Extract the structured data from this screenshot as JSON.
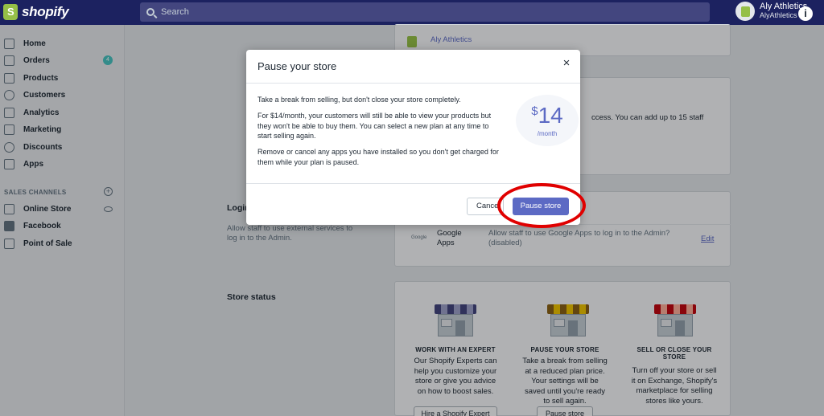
{
  "topbar": {
    "logo_text": "shopify",
    "search_placeholder": "Search",
    "account_name": "Aly Athletics",
    "account_sub": "AlyAthletics",
    "info_glyph": "i"
  },
  "sidebar": {
    "items": [
      {
        "label": "Home",
        "icon": "home-icon"
      },
      {
        "label": "Orders",
        "icon": "orders-icon",
        "badge": "4"
      },
      {
        "label": "Products",
        "icon": "tag-icon"
      },
      {
        "label": "Customers",
        "icon": "person-icon"
      },
      {
        "label": "Analytics",
        "icon": "bar-chart-icon"
      },
      {
        "label": "Marketing",
        "icon": "megaphone-icon"
      },
      {
        "label": "Discounts",
        "icon": "discount-icon"
      },
      {
        "label": "Apps",
        "icon": "apps-icon"
      }
    ],
    "sales_channels_heading": "SALES CHANNELS",
    "channels": [
      {
        "label": "Online Store",
        "icon": "store-icon"
      },
      {
        "label": "Facebook",
        "icon": "facebook-icon"
      },
      {
        "label": "Point of Sale",
        "icon": "bag-icon"
      }
    ]
  },
  "main": {
    "store_owner_name": "Aly Athletics",
    "staff_text": "ccess. You can add up to 15 staff",
    "login_title": "Login",
    "login_desc": "Allow staff to use external services to log in to the Admin.",
    "google_logo": "Google",
    "google_apps_label": "Google Apps",
    "google_apps_desc": "Allow staff to use Google Apps to log in to the Admin? (disabled)",
    "edit_link": "Edit",
    "store_status_title": "Store status",
    "columns": [
      {
        "title": "WORK WITH AN EXPERT",
        "desc": "Our Shopify Experts can help you customize your store or give you advice on how to boost sales.",
        "button": "Hire a Shopify Expert"
      },
      {
        "title": "PAUSE YOUR STORE",
        "desc": "Take a break from selling at a reduced plan price. Your settings will be saved until you're ready to sell again.",
        "button": "Pause store"
      },
      {
        "title": "SELL OR CLOSE YOUR STORE",
        "desc": "Turn off your store or sell it on Exchange, Shopify's marketplace for selling stores like yours.",
        "button": ""
      }
    ]
  },
  "modal": {
    "title": "Pause your store",
    "close_glyph": "×",
    "p1": "Take a break from selling, but don't close your store completely.",
    "p2": "For $14/month, your customers will still be able to view your products but they won't be able to buy them. You can select a new plan at any time to start selling again.",
    "p3": "Remove or cancel any apps you have installed so you don't get charged for them while your plan is paused.",
    "price_currency": "$",
    "price_amount": "14",
    "price_period": "/month",
    "cancel_label": "Cancel",
    "pause_label": "Pause store"
  },
  "colors": {
    "topbar": "#1c2260",
    "primary": "#5c6ac4",
    "annotation": "#e00000"
  }
}
